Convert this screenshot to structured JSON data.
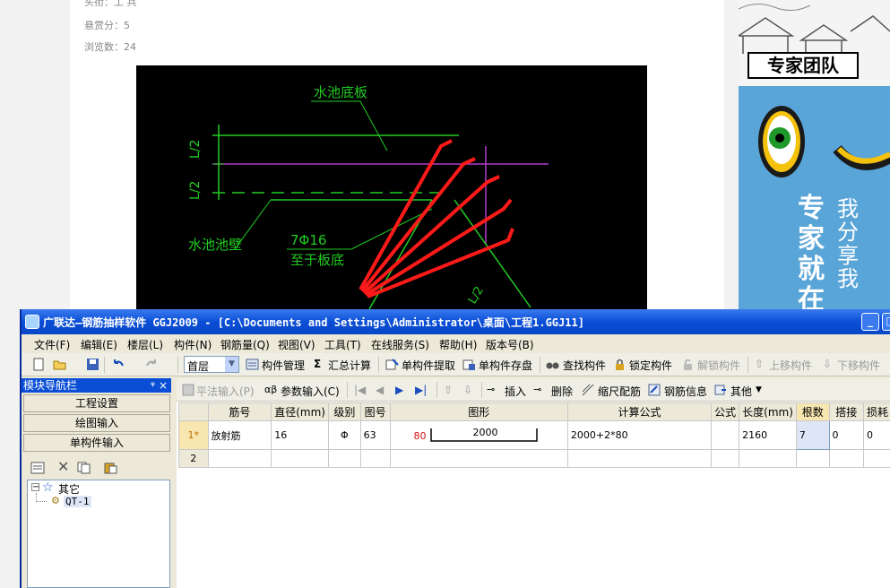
{
  "web": {
    "meta_author": "头衔：工     兵",
    "meta_reward": "悬赏分：5",
    "meta_views": "浏览数：24",
    "side_label": "专家团队",
    "side_promo_a": "专家就在",
    "side_promo_b": "我分享我"
  },
  "cad": {
    "label_floor": "水池底板",
    "label_wall": "水池池壁",
    "label_bar": "7Φ16",
    "label_bar_note": "至于板底",
    "label_l2_top": "L/2",
    "label_l2_bottom": "L/2",
    "label_bottom_right": "L/2",
    "bar_color": "#ff1a1a",
    "line_color": "#22cc22"
  },
  "window": {
    "title": "广联达—钢筋抽样软件 GGJ2009 - [C:\\Documents and Settings\\Administrator\\桌面\\工程1.GGJ11]",
    "minimize": "_",
    "maximize": "□"
  },
  "menu": [
    "文件(F)",
    "编辑(E)",
    "楼层(L)",
    "构件(N)",
    "钢筋量(Q)",
    "视图(V)",
    "工具(T)",
    "在线服务(S)",
    "帮助(H)",
    "版本号(B)"
  ],
  "toolbar": {
    "floor": "首层",
    "component_manage": "构件管理",
    "sum_calc": "汇总计算",
    "extract": "单构件提取",
    "save": "单构件存盘",
    "find": "查找构件",
    "lock": "锁定构件",
    "unlock": "解锁构件",
    "move_up": "上移构件",
    "move_down": "下移构件"
  },
  "nav": {
    "title": "模块导航栏",
    "pin": "ᵠ",
    "close": "×",
    "buttons": [
      "工程设置",
      "绘图输入",
      "单构件输入"
    ],
    "tree_root": "其它",
    "tree_child": "QT-1"
  },
  "grid_toolbar": {
    "flat_input": "平法输入(P)",
    "param_input": "参数输入(C)",
    "insert": "插入",
    "delete": "删除",
    "scale": "缩尺配筋",
    "rebar_info": "钢筋信息",
    "other": "其他"
  },
  "grid": {
    "headers": [
      "",
      "筋号",
      "直径(mm)",
      "级别",
      "图号",
      "图形",
      "计算公式",
      "公式",
      "长度(mm)",
      "根数",
      "搭接",
      "损耗"
    ],
    "rows": [
      {
        "num": "1*",
        "name": "放射筋",
        "diameter": "16",
        "grade": "Φ",
        "fig": "63",
        "shape_left": "80",
        "shape_main": "2000",
        "formula": "2000+2*80",
        "formula_desc": "",
        "length": "2160",
        "count": "7",
        "lap": "0",
        "loss": "0"
      },
      {
        "num": "2",
        "name": "",
        "diameter": "",
        "grade": "",
        "fig": "",
        "shape_left": "",
        "shape_main": "",
        "formula": "",
        "formula_desc": "",
        "length": "",
        "count": "",
        "lap": "",
        "loss": ""
      }
    ]
  }
}
